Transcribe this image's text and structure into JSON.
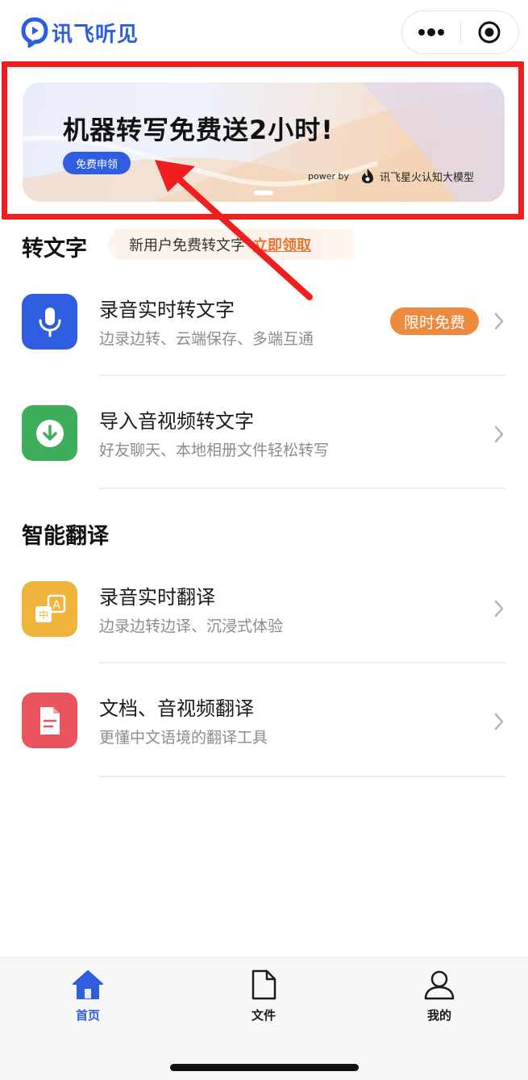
{
  "header": {
    "app_name": "讯飞听见",
    "more_icon": "more-dots-icon",
    "close_icon": "target-close-icon"
  },
  "banner": {
    "title": "机器转写免费送2小时!",
    "button_label": "免费申领",
    "power_by": "power by",
    "model_name": "讯飞星火认知大模型",
    "slide_count": 1,
    "active_slide": 1
  },
  "section_transcribe": {
    "title": "转文字",
    "promo_text": "新用户免费转文字",
    "promo_link": "立即领取",
    "items": [
      {
        "title": "录音实时转文字",
        "subtitle": "边录边转、云端保存、多端互通",
        "badge": "限时免费",
        "icon": "microphone-icon",
        "color": "#2f5de0"
      },
      {
        "title": "导入音视频转文字",
        "subtitle": "好友聊天、本地相册文件轻松转写",
        "badge": "",
        "icon": "download-icon",
        "color": "#3fae5a"
      }
    ]
  },
  "section_translate": {
    "title": "智能翻译",
    "items": [
      {
        "title": "录音实时翻译",
        "subtitle": "边录边转边译、沉浸式体验",
        "icon": "translate-icon",
        "color": "#f0b43a"
      },
      {
        "title": "文档、音视频翻译",
        "subtitle": "更懂中文语境的翻译工具",
        "icon": "document-icon",
        "color": "#e9545e"
      }
    ]
  },
  "tabbar": {
    "tabs": [
      {
        "label": "首页",
        "icon": "home-icon",
        "active": true
      },
      {
        "label": "文件",
        "icon": "file-icon",
        "active": false
      },
      {
        "label": "我的",
        "icon": "profile-icon",
        "active": false
      }
    ]
  },
  "colors": {
    "accent": "#2f5de0",
    "orange": "#ee8a3d",
    "annotation_red": "#f01e1e"
  }
}
